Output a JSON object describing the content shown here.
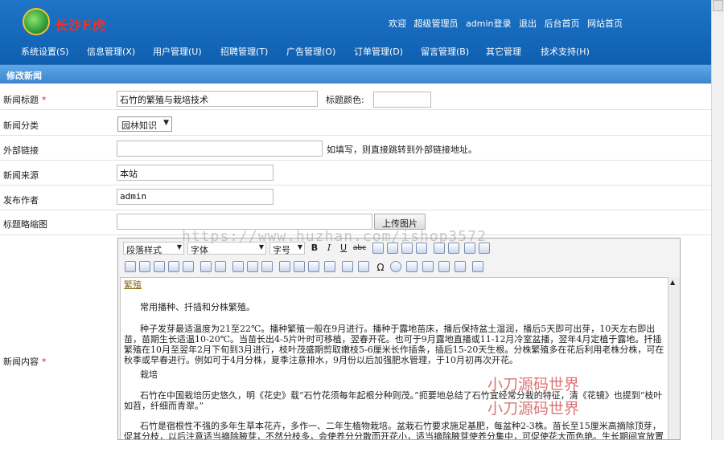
{
  "header": {
    "logo_text": "长沙E虎",
    "top_links": [
      "欢迎",
      "超级管理员",
      "admin登录",
      "退出",
      "后台首页",
      "网站首页"
    ]
  },
  "nav": [
    "系统设置(S)",
    "信息管理(X)",
    "用户管理(U)",
    "招聘管理(T)",
    "广告管理(O)",
    "订单管理(D)",
    "留言管理(B)",
    "其它管理",
    "技术支持(H)"
  ],
  "page_title": "修改新闻",
  "form": {
    "title_label": "新闻标题",
    "title_value": "石竹的繁殖与栽培技术",
    "title_color_label": "标题颜色:",
    "title_color_value": "",
    "category_label": "新闻分类",
    "category_value": "园林知识",
    "link_label": "外部链接",
    "link_value": "",
    "link_hint": "如填写，则直接跳转到外部链接地址。",
    "source_label": "新闻来源",
    "source_value": "本站",
    "author_label": "发布作者",
    "author_value": "admin",
    "thumb_label": "标题略缩图",
    "thumb_value": "",
    "upload_button": "上传图片",
    "content_label": "新闻内容",
    "required_mark": "*"
  },
  "editor": {
    "paragraph_select": "段落样式",
    "font_select": "字体",
    "size_select": "字号",
    "bold": "B",
    "italic": "I",
    "underline": "U",
    "strike": "abc",
    "special_char": "Ω",
    "content": {
      "heading": "繁殖",
      "p1": "常用播种、扦插和分株繁殖。",
      "p2": "种子发芽最适温度为21至22℃。播种繁殖一般在9月进行。播种于露地苗床，播后保持盆土湿润，播后5天即可出芽，10天左右即出苗，苗期生长适温10-20℃。当苗长出4-5片叶时可移植，翌春开花。也可于9月露地直播或11-12月冷室盆播，翌年4月定植于露地。扦插繁殖在10月至翌年2月下旬到3月进行，枝叶茂盛期剪取嫩枝5-6厘米长作插条，插后15-20天生根。分株繁殖多在花后利用老株分株，可在秋季或早春进行。例如可于4月分株，夏季注意排水，9月份以后加强肥水管理，于10月初再次开花。",
      "p3": "栽培",
      "p4": "石竹在中国栽培历史悠久，明《花史》载“石竹花须每年起根分种则茂。”扼要地总结了石竹宜经常分栽的特征，清《花镜》也提到“枝叶如苕，纤细而青翠。”",
      "p5": "石竹是宿根性不强的多年生草本花卉，多作一、二年生植物栽培。盆栽石竹要求施足基肥，每盆种2-3株。苗长至15厘米高摘除顶芽，促其分枝，以后注意适当摘除腋芽，不然分枝多，会使养分分散而开花小，适当摘除腋芽使养分集中，可促使花大而色艳。生长期间宜放置在向阳、通风"
    }
  },
  "watermarks": {
    "url": "https://www.huzhan.com/ishop3572",
    "red_1": "小刀源码世界",
    "red_2": "小刀源码世界"
  }
}
